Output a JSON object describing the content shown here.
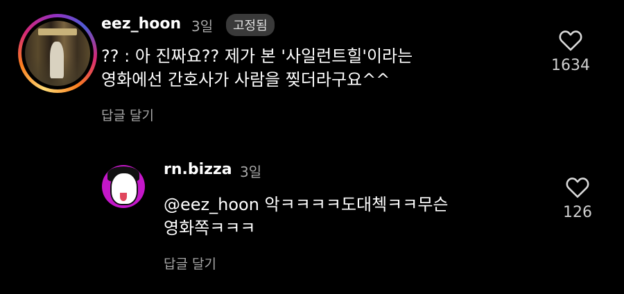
{
  "comments": [
    {
      "username": "eez_hoon",
      "time": "3일",
      "badge": "고정됨",
      "line1": "?? : 아 진짜요?? 제가 본 '사일런트힐'이라는",
      "line2": "영화에선 간호사가 사람을 찢더라구요^^",
      "reply_label": "답글 달기",
      "likes": "1634"
    },
    {
      "username": "rn.bizza",
      "time": "3일",
      "line1": "@eez_hoon 악ㅋㅋㅋㅋ도대첵ㅋㅋ무슨",
      "line2": "영화쪽ㅋㅋㅋ",
      "reply_label": "답글 달기",
      "likes": "126"
    }
  ],
  "icons": {
    "heart": "heart-outline-icon"
  },
  "colors": {
    "background": "#000000",
    "text_primary": "#ffffff",
    "text_secondary": "#a8a8a8",
    "badge_bg": "#3a3a3a"
  }
}
